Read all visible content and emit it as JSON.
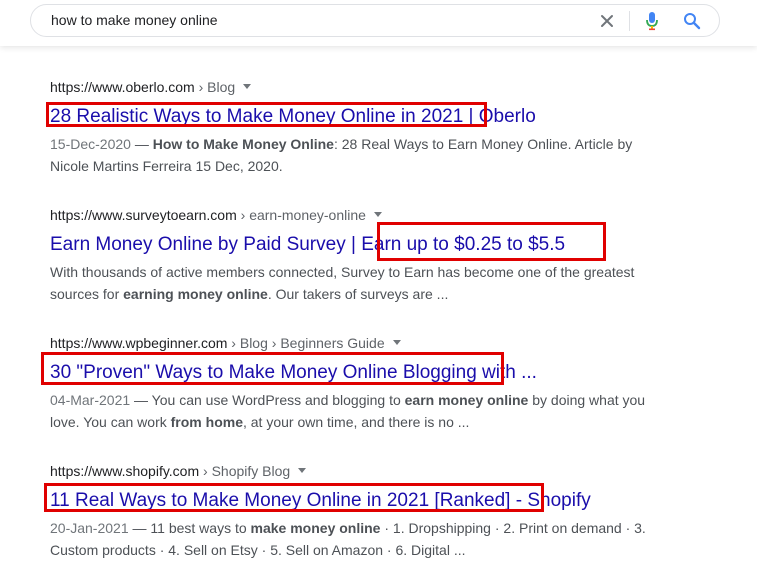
{
  "search": {
    "query": "how to make money online"
  },
  "results": [
    {
      "site": "https://www.oberlo.com",
      "path": " › Blog",
      "title_a": "28 Realistic Ways to Make Money Online in 2021",
      "title_b": " | Oberlo",
      "date": "15-Dec-2020",
      "snippet_1": " — ",
      "snippet_b1": "How to Make Money Online",
      "snippet_2": ": 28 Real Ways to Earn Money Online. Article by Nicole Martins Ferreira 15 Dec, 2020."
    },
    {
      "site": "https://www.surveytoearn.com",
      "path": " › earn-money-online",
      "title_a": "Earn Money Online by Paid Survey | ",
      "title_b": "Earn up to $0.25 to $5.5",
      "snippet_1": "With thousands of active members connected, Survey to Earn has become one of the greatest sources for ",
      "snippet_b1": "earning money online",
      "snippet_2": ". Our takers of surveys are ..."
    },
    {
      "site": "https://www.wpbeginner.com",
      "path": " › Blog › Beginners Guide",
      "title_a": "30 \"Proven\" Ways to Make Money Online Blogging",
      "title_b": " with ...",
      "date": "04-Mar-2021",
      "snippet_1": " — You can use WordPress and blogging to ",
      "snippet_b1": "earn money online",
      "snippet_2": " by doing what you love. You can work ",
      "snippet_b2": "from home",
      "snippet_3": ", at your own time, and there is no ..."
    },
    {
      "site": "https://www.shopify.com",
      "path": " › Shopify Blog",
      "title_a": "11 Real Ways to Make Money Online in 2021 [Ranked]",
      "title_b": " - Shopify",
      "date": "20-Jan-2021",
      "snippet_1": " — 11 best ways to ",
      "snippet_b1": "make money online",
      "snippet_2": " · 1. Dropshipping · 2. Print on demand · 3. Custom products · 4. Sell on Etsy · 5. Sell on Amazon · 6. Digital ..."
    }
  ],
  "colors": {
    "link": "#1a0dab",
    "highlight_box": "#e00000"
  },
  "icons": [
    "clear-icon",
    "microphone-icon",
    "search-icon",
    "dropdown-caret-icon"
  ]
}
